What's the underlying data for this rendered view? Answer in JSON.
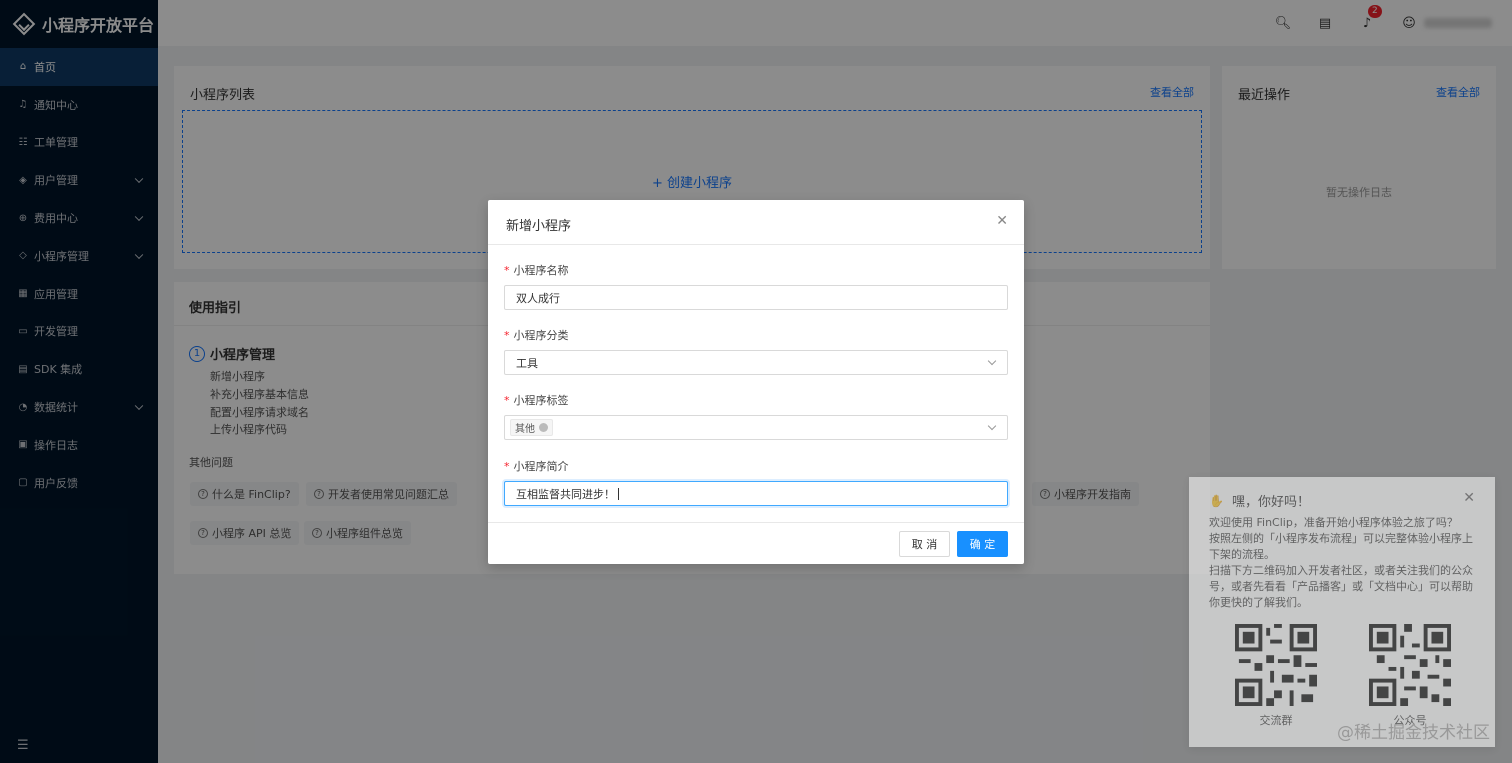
{
  "app": {
    "title": "小程序开放平台"
  },
  "sidebar": {
    "items": [
      {
        "label": "首页",
        "icon": "⌂",
        "active": true,
        "expandable": false
      },
      {
        "label": "通知中心",
        "icon": "♫",
        "active": false,
        "expandable": false
      },
      {
        "label": "工单管理",
        "icon": "☷",
        "active": false,
        "expandable": false
      },
      {
        "label": "用户管理",
        "icon": "◈",
        "active": false,
        "expandable": true
      },
      {
        "label": "费用中心",
        "icon": "⊕",
        "active": false,
        "expandable": true
      },
      {
        "label": "小程序管理",
        "icon": "◇",
        "active": false,
        "expandable": true
      },
      {
        "label": "应用管理",
        "icon": "▦",
        "active": false,
        "expandable": false
      },
      {
        "label": "开发管理",
        "icon": "▭",
        "active": false,
        "expandable": false
      },
      {
        "label": "SDK 集成",
        "icon": "▤",
        "active": false,
        "expandable": false
      },
      {
        "label": "数据统计",
        "icon": "◔",
        "active": false,
        "expandable": true
      },
      {
        "label": "操作日志",
        "icon": "▣",
        "active": false,
        "expandable": false
      },
      {
        "label": "用户反馈",
        "icon": "▢",
        "active": false,
        "expandable": false
      }
    ],
    "collapse_icon": "☰"
  },
  "topbar": {
    "notification_count": "2"
  },
  "miniapp_list": {
    "title": "小程序列表",
    "view_all": "查看全部",
    "create_label": "+ 创建小程序"
  },
  "recent_ops": {
    "title": "最近操作",
    "view_all": "查看全部",
    "empty": "暂无操作日志"
  },
  "guide": {
    "title": "使用指引",
    "step_number": "1",
    "step_title": "小程序管理",
    "step_items": [
      "新增小程序",
      "补充小程序基本信息",
      "配置小程序请求域名",
      "上传小程序代码"
    ],
    "other_title": "其他问题",
    "questions": [
      "什么是 FinClip?",
      "开发者使用常见问题汇总",
      "小程序开发指南",
      "小程序 API 总览",
      "小程序组件总览"
    ]
  },
  "welcome": {
    "title": "嘿，你好吗！",
    "lines": [
      "欢迎使用 FinClip，准备开始小程序体验之旅了吗？",
      "按照左侧的「小程序发布流程」可以完整体验小程序上下架的流程。",
      "扫描下方二维码加入开发者社区，或者关注我们的公众号，或者先看看「产品播客」或「文档中心」可以帮助你更快的了解我们。"
    ],
    "qr1_label": "交流群",
    "qr2_label": "公众号"
  },
  "watermark": "@稀土掘金技术社区",
  "modal": {
    "title": "新增小程序",
    "fields": {
      "name": {
        "label": "小程序名称",
        "value": "双人成行"
      },
      "category": {
        "label": "小程序分类",
        "value": "工具"
      },
      "tags": {
        "label": "小程序标签",
        "tag": "其他"
      },
      "intro": {
        "label": "小程序简介",
        "value": "互相监督共同进步！"
      }
    },
    "cancel_label": "取 消",
    "ok_label": "确 定"
  },
  "colors": {
    "sidebar_bg": "#001529",
    "primary": "#1890ff",
    "active_nav": "#0f3a64"
  }
}
